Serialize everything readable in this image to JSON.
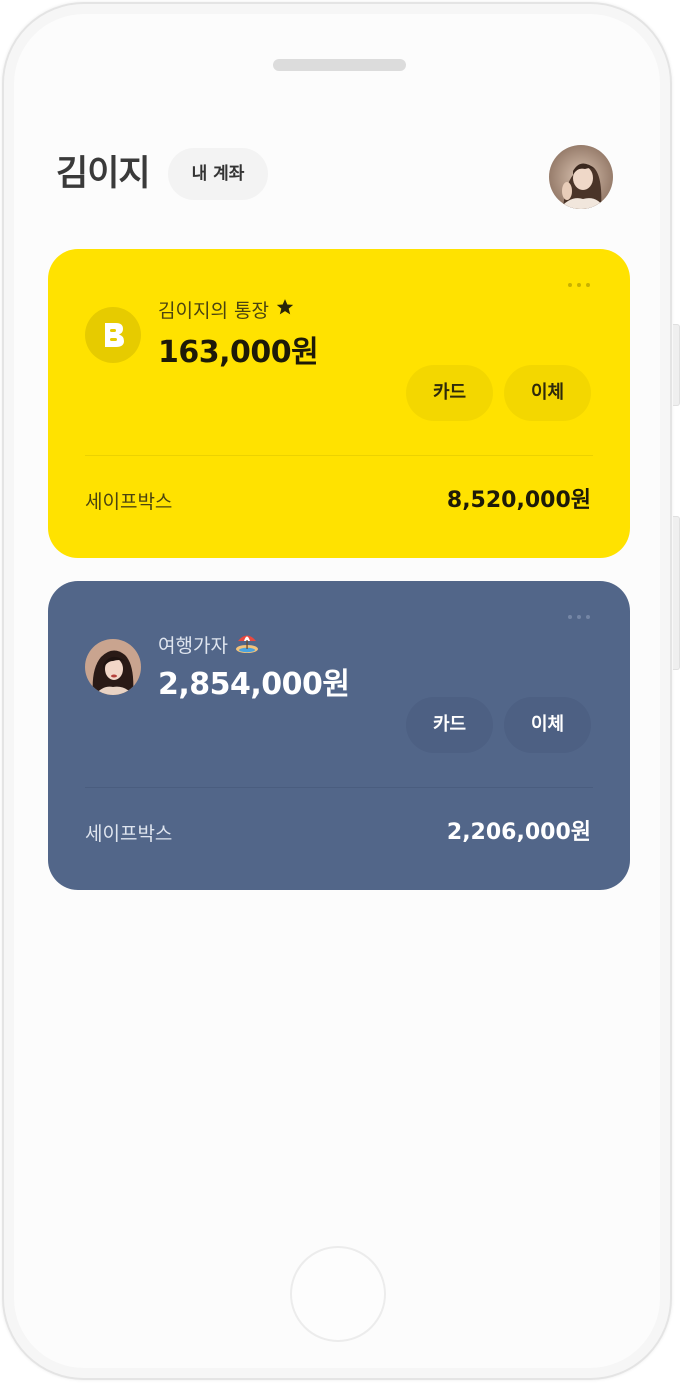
{
  "header": {
    "name": "김이지",
    "chip_label": "내 계좌"
  },
  "accounts": [
    {
      "name": "김이지의 통장",
      "name_icon": "star-icon",
      "balance": "163,000원",
      "card_label": "카드",
      "transfer_label": "이체",
      "safebox_label": "세이프박스",
      "safebox_amount": "8,520,000원",
      "color": "#ffe200",
      "icon": "bank-b-icon"
    },
    {
      "name": "여행가자",
      "name_icon": "beach-umbrella-icon",
      "balance": "2,854,000원",
      "card_label": "카드",
      "transfer_label": "이체",
      "safebox_label": "세이프박스",
      "safebox_amount": "2,206,000원",
      "color": "#526689",
      "icon": "photo-avatar"
    }
  ],
  "colors": {
    "yellow_card": "#ffe200",
    "blue_card": "#526689",
    "page_bg": "#fcfcfc"
  }
}
